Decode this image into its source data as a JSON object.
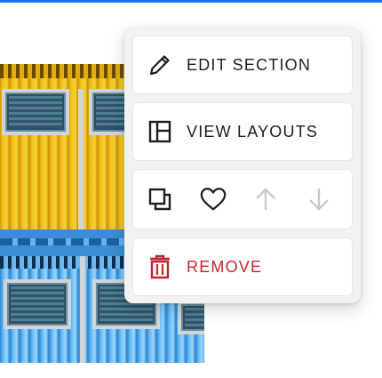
{
  "menu": {
    "edit_section": {
      "label": "EDIT SECTION",
      "icon": "pencil-icon"
    },
    "view_layouts": {
      "label": "VIEW LAYOUTS",
      "icon": "layout-icon"
    },
    "actions": [
      {
        "icon": "duplicate-icon",
        "enabled": true
      },
      {
        "icon": "heart-icon",
        "enabled": true
      },
      {
        "icon": "arrow-up-icon",
        "enabled": false
      },
      {
        "icon": "arrow-down-icon",
        "enabled": false
      }
    ],
    "remove": {
      "label": "REMOVE",
      "icon": "trash-icon"
    }
  },
  "colors": {
    "accent_line": "#1a73e8",
    "danger": "#c0282f",
    "disabled": "#c8c8c8",
    "menu_bg": "#f2f2f2"
  }
}
